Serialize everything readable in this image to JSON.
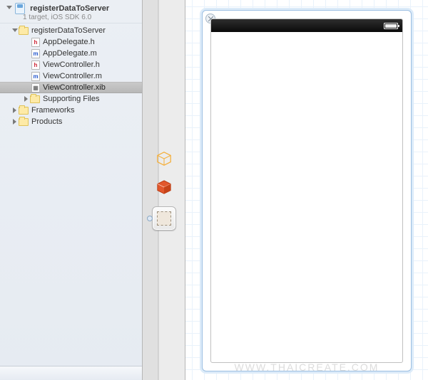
{
  "navigator": {
    "project": {
      "title": "registerDataToServer",
      "subtitle": "1 target, iOS SDK 6.0"
    },
    "tree": {
      "group": {
        "name": "registerDataToServer"
      },
      "files": [
        {
          "name": "AppDelegate.h",
          "kind": "h"
        },
        {
          "name": "AppDelegate.m",
          "kind": "m"
        },
        {
          "name": "ViewController.h",
          "kind": "h"
        },
        {
          "name": "ViewController.m",
          "kind": "m"
        },
        {
          "name": "ViewController.xib",
          "kind": "xib",
          "selected": true
        }
      ],
      "supporting": {
        "name": "Supporting Files"
      },
      "frameworks": {
        "name": "Frameworks"
      },
      "products": {
        "name": "Products"
      }
    }
  },
  "dock": {
    "items": [
      "files-owner-icon",
      "first-responder-icon",
      "view-icon"
    ]
  },
  "watermark": "WWW.THAICREATE.COM"
}
